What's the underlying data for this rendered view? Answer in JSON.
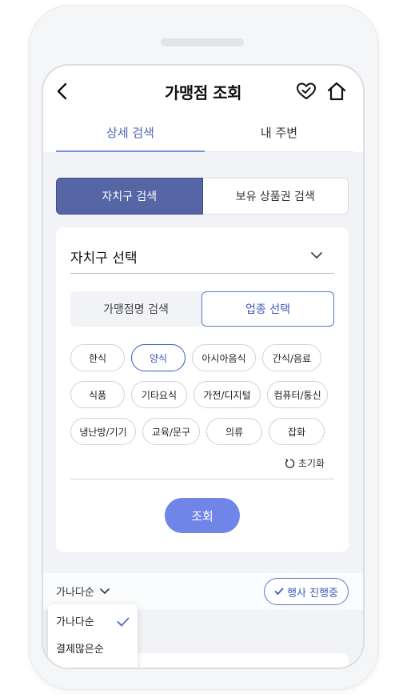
{
  "header": {
    "title": "가맹점 조회"
  },
  "tabs": [
    {
      "label": "상세 검색",
      "active": true
    },
    {
      "label": "내 주변",
      "active": false
    }
  ],
  "search_mode": {
    "options": [
      {
        "label": "자치구 검색",
        "active": true
      },
      {
        "label": "보유 상품권 검색",
        "active": false
      }
    ]
  },
  "district": {
    "label": "자치구 선택"
  },
  "filter_mode": {
    "options": [
      {
        "label": "가맹점명 검색",
        "active": false
      },
      {
        "label": "업종 선택",
        "active": true
      }
    ]
  },
  "categories": [
    {
      "label": "한식",
      "selected": false
    },
    {
      "label": "양식",
      "selected": true
    },
    {
      "label": "아시아음식",
      "selected": false
    },
    {
      "label": "간식/음료",
      "selected": false
    },
    {
      "label": "식품",
      "selected": false
    },
    {
      "label": "기타요식",
      "selected": false
    },
    {
      "label": "가전/디지털",
      "selected": false
    },
    {
      "label": "컴퓨터/통신",
      "selected": false
    },
    {
      "label": "냉난방/기기",
      "selected": false
    },
    {
      "label": "교육/문구",
      "selected": false
    },
    {
      "label": "의류",
      "selected": false
    },
    {
      "label": "잡화",
      "selected": false
    }
  ],
  "reset_label": "초기화",
  "search_button": "조회",
  "sort": {
    "current": "가나다순",
    "options": [
      {
        "label": "가나다순",
        "checked": true
      },
      {
        "label": "결제많은순",
        "checked": false
      }
    ]
  },
  "event_filter": "행사 진행중",
  "colors": {
    "accent": "#5565a6",
    "primary_blue": "#3f58b8",
    "search_button": "#6f86e8"
  },
  "icons": [
    "back-arrow-icon",
    "heart-icon",
    "home-icon",
    "chevron-down-icon",
    "reset-icon",
    "check-icon"
  ]
}
